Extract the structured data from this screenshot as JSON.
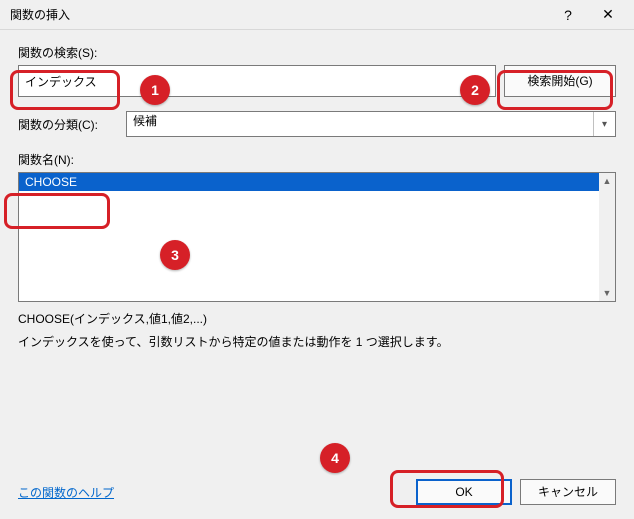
{
  "titlebar": {
    "title": "関数の挿入",
    "help": "?",
    "close": "✕"
  },
  "search": {
    "label": "関数の検索(S):",
    "value": "インデックス",
    "go_label": "検索開始(G)"
  },
  "category": {
    "label": "関数の分類(C):",
    "value": "候補"
  },
  "funcname_label": "関数名(N):",
  "list": {
    "items": [
      "CHOOSE"
    ],
    "selected_index": 0
  },
  "syntax": "CHOOSE(インデックス,値1,値2,...)",
  "description": "インデックスを使って、引数リストから特定の値または動作を 1 つ選択します。",
  "help_link": "この関数のヘルプ",
  "buttons": {
    "ok": "OK",
    "cancel": "キャンセル"
  },
  "annotations": {
    "b1": "1",
    "b2": "2",
    "b3": "3",
    "b4": "4"
  }
}
